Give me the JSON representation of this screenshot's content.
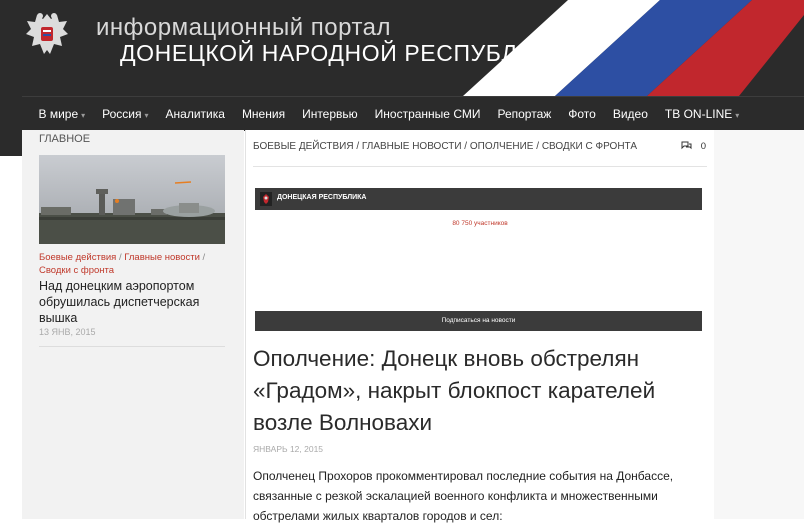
{
  "colors": {
    "header_bg": "#2b2b2b",
    "flag_blue": "#2d4fa3",
    "flag_red": "#c1272d",
    "accent": "#c0392b"
  },
  "header": {
    "site_line1": "информационный портал",
    "site_line2": "ДОНЕЦКОЙ НАРОДНОЙ РЕСПУБЛИКИ",
    "logo_icon": "double-headed-eagle-emblem"
  },
  "nav": {
    "items": [
      {
        "label": "В мире",
        "has_dropdown": true
      },
      {
        "label": "Россия",
        "has_dropdown": true
      },
      {
        "label": "Аналитика",
        "has_dropdown": false
      },
      {
        "label": "Мнения",
        "has_dropdown": false
      },
      {
        "label": "Интервью",
        "has_dropdown": false
      },
      {
        "label": "Иностранные СМИ",
        "has_dropdown": false
      },
      {
        "label": "Репортаж",
        "has_dropdown": false
      },
      {
        "label": "Фото",
        "has_dropdown": false
      },
      {
        "label": "Видео",
        "has_dropdown": false
      },
      {
        "label": "ТВ ON-LINE",
        "has_dropdown": true
      }
    ]
  },
  "sidebar": {
    "heading": "ГЛАВНОЕ",
    "post": {
      "categories": [
        "Боевые действия",
        "Главные новости",
        "Сводки с фронта"
      ],
      "title": "Над донецким аэропортом обрушилась диспетчерская вышка",
      "date": "13 ЯНВ, 2015"
    }
  },
  "article": {
    "breadcrumbs": [
      "БОЕВЫЕ ДЕЙСТВИЯ",
      "ГЛАВНЫЕ НОВОСТИ",
      "ОПОЛЧЕНИЕ",
      "СВОДКИ С ФРОНТА"
    ],
    "comments_icon": "comments-icon",
    "comments_count": "0",
    "title": "Ополчение: Донецк вновь обстрелян «Градом», накрыт блокпост карателей возле Волновахи",
    "date": "ЯНВАРЬ 12, 2015",
    "body": "Ополченец Прохоров прокомментировал последние события на Донбассе, связанные с резкой эскалацией военного конфликта и множественными обстрелами жилых кварталов городов и сел:"
  },
  "widget": {
    "group_name": "ДОНЕЦКАЯ РЕСПУБЛИКА",
    "members": "80 750 участников",
    "subscribe_label": "Подписаться на новости"
  }
}
